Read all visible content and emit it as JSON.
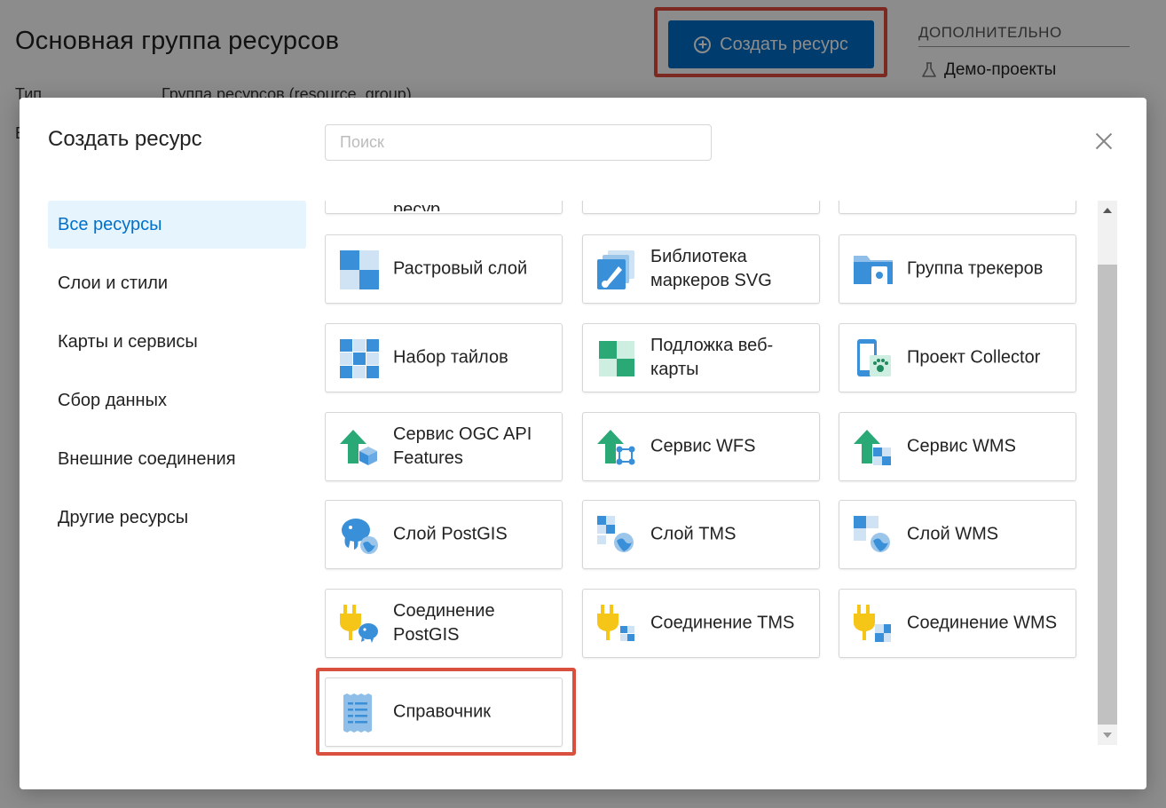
{
  "page": {
    "title": "Основная группа ресурсов",
    "create_button": "Создать ресурс",
    "side_heading": "ДОПОЛНИТЕЛЬНО",
    "side_link": "Демо-проекты",
    "meta_label": "Тип",
    "meta_value": "Группа ресурсов (resource_group)",
    "meta_label2": "В"
  },
  "modal": {
    "title": "Создать ресурс",
    "search_placeholder": "Поиск",
    "categories": [
      {
        "label": "Все ресурсы",
        "active": true
      },
      {
        "label": "Слои и стили"
      },
      {
        "label": "Карты и сервисы"
      },
      {
        "label": "Сбор данных"
      },
      {
        "label": "Внешние соединения"
      },
      {
        "label": "Другие ресурсы"
      }
    ],
    "resources": [
      {
        "label": "ресур",
        "icon": "partial-icon"
      },
      {
        "label": "",
        "icon": "partial-icon"
      },
      {
        "label": "",
        "icon": "partial-icon"
      },
      {
        "label": "Растровый слой",
        "icon": "raster-layer-icon"
      },
      {
        "label": "Библиотека маркеров SVG",
        "icon": "svg-marker-library-icon"
      },
      {
        "label": "Группа трекеров",
        "icon": "tracker-group-icon"
      },
      {
        "label": "Набор тайлов",
        "icon": "tileset-icon"
      },
      {
        "label": "Подложка веб-карты",
        "icon": "basemap-icon"
      },
      {
        "label": "Проект Collector",
        "icon": "collector-project-icon"
      },
      {
        "label": "Сервис OGC API Features",
        "icon": "ogc-api-service-icon"
      },
      {
        "label": "Сервис WFS",
        "icon": "wfs-service-icon"
      },
      {
        "label": "Сервис WMS",
        "icon": "wms-service-icon"
      },
      {
        "label": "Слой PostGIS",
        "icon": "postgis-layer-icon"
      },
      {
        "label": "Слой TMS",
        "icon": "tms-layer-icon"
      },
      {
        "label": "Слой WMS",
        "icon": "wms-layer-icon"
      },
      {
        "label": "Соединение PostGIS",
        "icon": "postgis-connection-icon"
      },
      {
        "label": "Соединение TMS",
        "icon": "tms-connection-icon"
      },
      {
        "label": "Соединение WMS",
        "icon": "wms-connection-icon"
      },
      {
        "label": "Справочник",
        "icon": "lookup-table-icon"
      }
    ]
  }
}
